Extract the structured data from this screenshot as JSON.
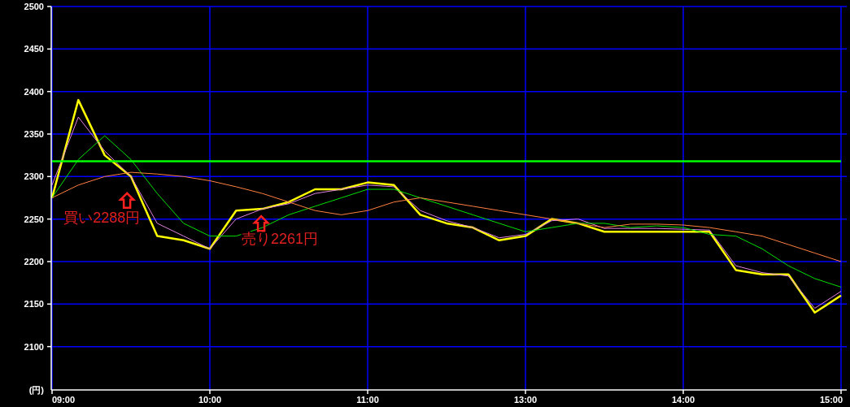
{
  "chart_data": {
    "type": "line",
    "ylabel": "(円)",
    "grid": true,
    "categories": [
      "09:00",
      null,
      null,
      null,
      null,
      null,
      "10:00",
      null,
      null,
      null,
      null,
      null,
      "11:00",
      null,
      null,
      null,
      null,
      null,
      "13:00",
      null,
      null,
      null,
      null,
      null,
      "14:00",
      null,
      null,
      null,
      null,
      null,
      "15:00"
    ],
    "series": [
      {
        "color": "#ffff00",
        "values": [
          2275,
          2390,
          2325,
          2300,
          2230,
          2225,
          2215,
          2260,
          2262,
          2270,
          2285,
          2285,
          2293,
          2290,
          2255,
          2245,
          2240,
          2225,
          2230,
          2250,
          2245,
          2235,
          2235,
          2235,
          2235,
          2235,
          2190,
          2185,
          2185,
          2140,
          2160
        ]
      },
      {
        "color": "#e080e0",
        "values": [
          2290,
          2370,
          2330,
          2300,
          2245,
          2230,
          2215,
          2250,
          2262,
          2268,
          2280,
          2285,
          2290,
          2288,
          2260,
          2248,
          2240,
          2228,
          2232,
          2248,
          2250,
          2239,
          2239,
          2239,
          2238,
          2237,
          2195,
          2187,
          2183,
          2145,
          2165
        ]
      },
      {
        "color": "#00e000",
        "values": [
          2275,
          2320,
          2348,
          2320,
          2280,
          2245,
          2230,
          2230,
          2240,
          2255,
          2265,
          2275,
          2285,
          2285,
          2275,
          2265,
          2255,
          2245,
          2235,
          2240,
          2245,
          2245,
          2240,
          2242,
          2240,
          2232,
          2230,
          2215,
          2195,
          2180,
          2170
        ]
      },
      {
        "color": "#ff8040",
        "values": [
          2275,
          2290,
          2300,
          2305,
          2303,
          2300,
          2295,
          2288,
          2280,
          2270,
          2260,
          2255,
          2260,
          2270,
          2275,
          2270,
          2265,
          2260,
          2255,
          2250,
          2245,
          2240,
          2244,
          2244,
          2243,
          2240,
          2235,
          2230,
          2220,
          2210,
          2200
        ]
      },
      {
        "color": "#00ff00",
        "values": [
          2318,
          2318,
          2318,
          2318,
          2318,
          2318,
          2318,
          2318,
          2318,
          2318,
          2318,
          2318,
          2318,
          2318,
          2318,
          2318,
          2318,
          2318,
          2318,
          2318,
          2318,
          2318,
          2318,
          2318,
          2318,
          2318,
          2318,
          2318,
          2318,
          2318,
          2318
        ]
      }
    ],
    "ylim": [
      2049,
      2500
    ],
    "yticks": [
      2100,
      2150,
      2200,
      2250,
      2300,
      2350,
      2400,
      2450,
      2500
    ],
    "annotations": [
      "買い2288円",
      "売り2261円"
    ]
  }
}
